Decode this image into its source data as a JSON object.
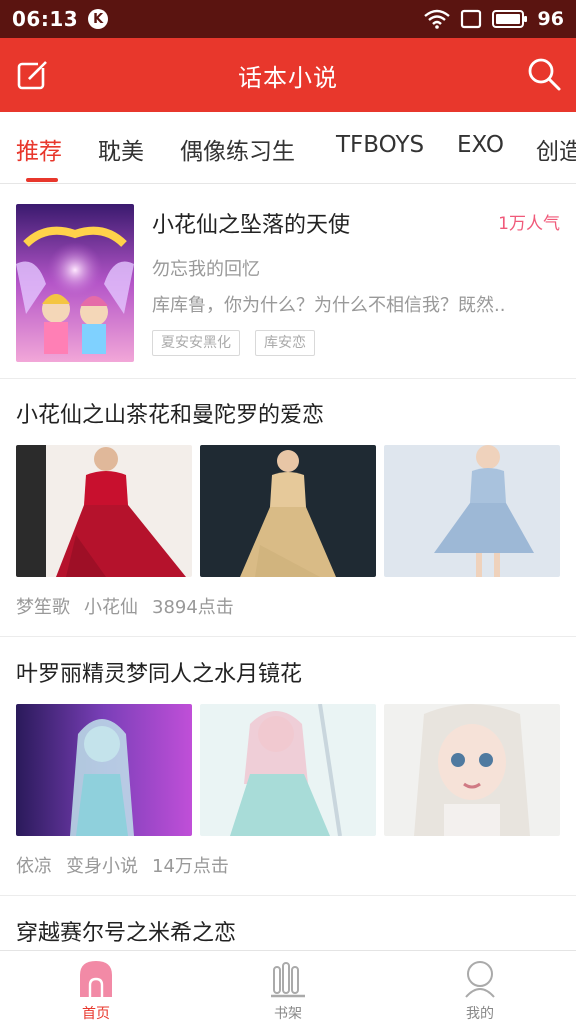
{
  "status_bar": {
    "time": "06:13",
    "k_badge": "K",
    "battery": "96",
    "icons": [
      "wifi-icon",
      "screen-icon",
      "battery-icon"
    ]
  },
  "header": {
    "title": "话本小说",
    "left_icon": "edit-icon",
    "right_icon": "search-icon",
    "color": "#e8372c"
  },
  "tabs": [
    "推荐",
    "耽美",
    "偶像练习生",
    "TFBOYS",
    "EXO",
    "创造"
  ],
  "active_tab": 0,
  "featured": {
    "title": "小花仙之坠落的天使",
    "popularity": "1万人气",
    "author": "勿忘我的回忆",
    "description": "库库鲁，你为什么？为什么不相信我？既然..",
    "tags": [
      "夏安安黑化",
      "库安恋"
    ]
  },
  "stories": [
    {
      "title": "小花仙之山茶花和曼陀罗的爱恋",
      "author": "梦笙歌",
      "category": "小花仙",
      "clicks": "3894点击"
    },
    {
      "title": "叶罗丽精灵梦同人之水月镜花",
      "author": "依凉",
      "category": "变身小说",
      "clicks": "14万点击"
    },
    {
      "title": "穿越赛尔号之米希之恋"
    }
  ],
  "bottom_nav": [
    {
      "label": "首页",
      "icon": "home-icon"
    },
    {
      "label": "书架",
      "icon": "bookshelf-icon"
    },
    {
      "label": "我的",
      "icon": "profile-icon"
    }
  ],
  "accent_color": "#e8372c"
}
